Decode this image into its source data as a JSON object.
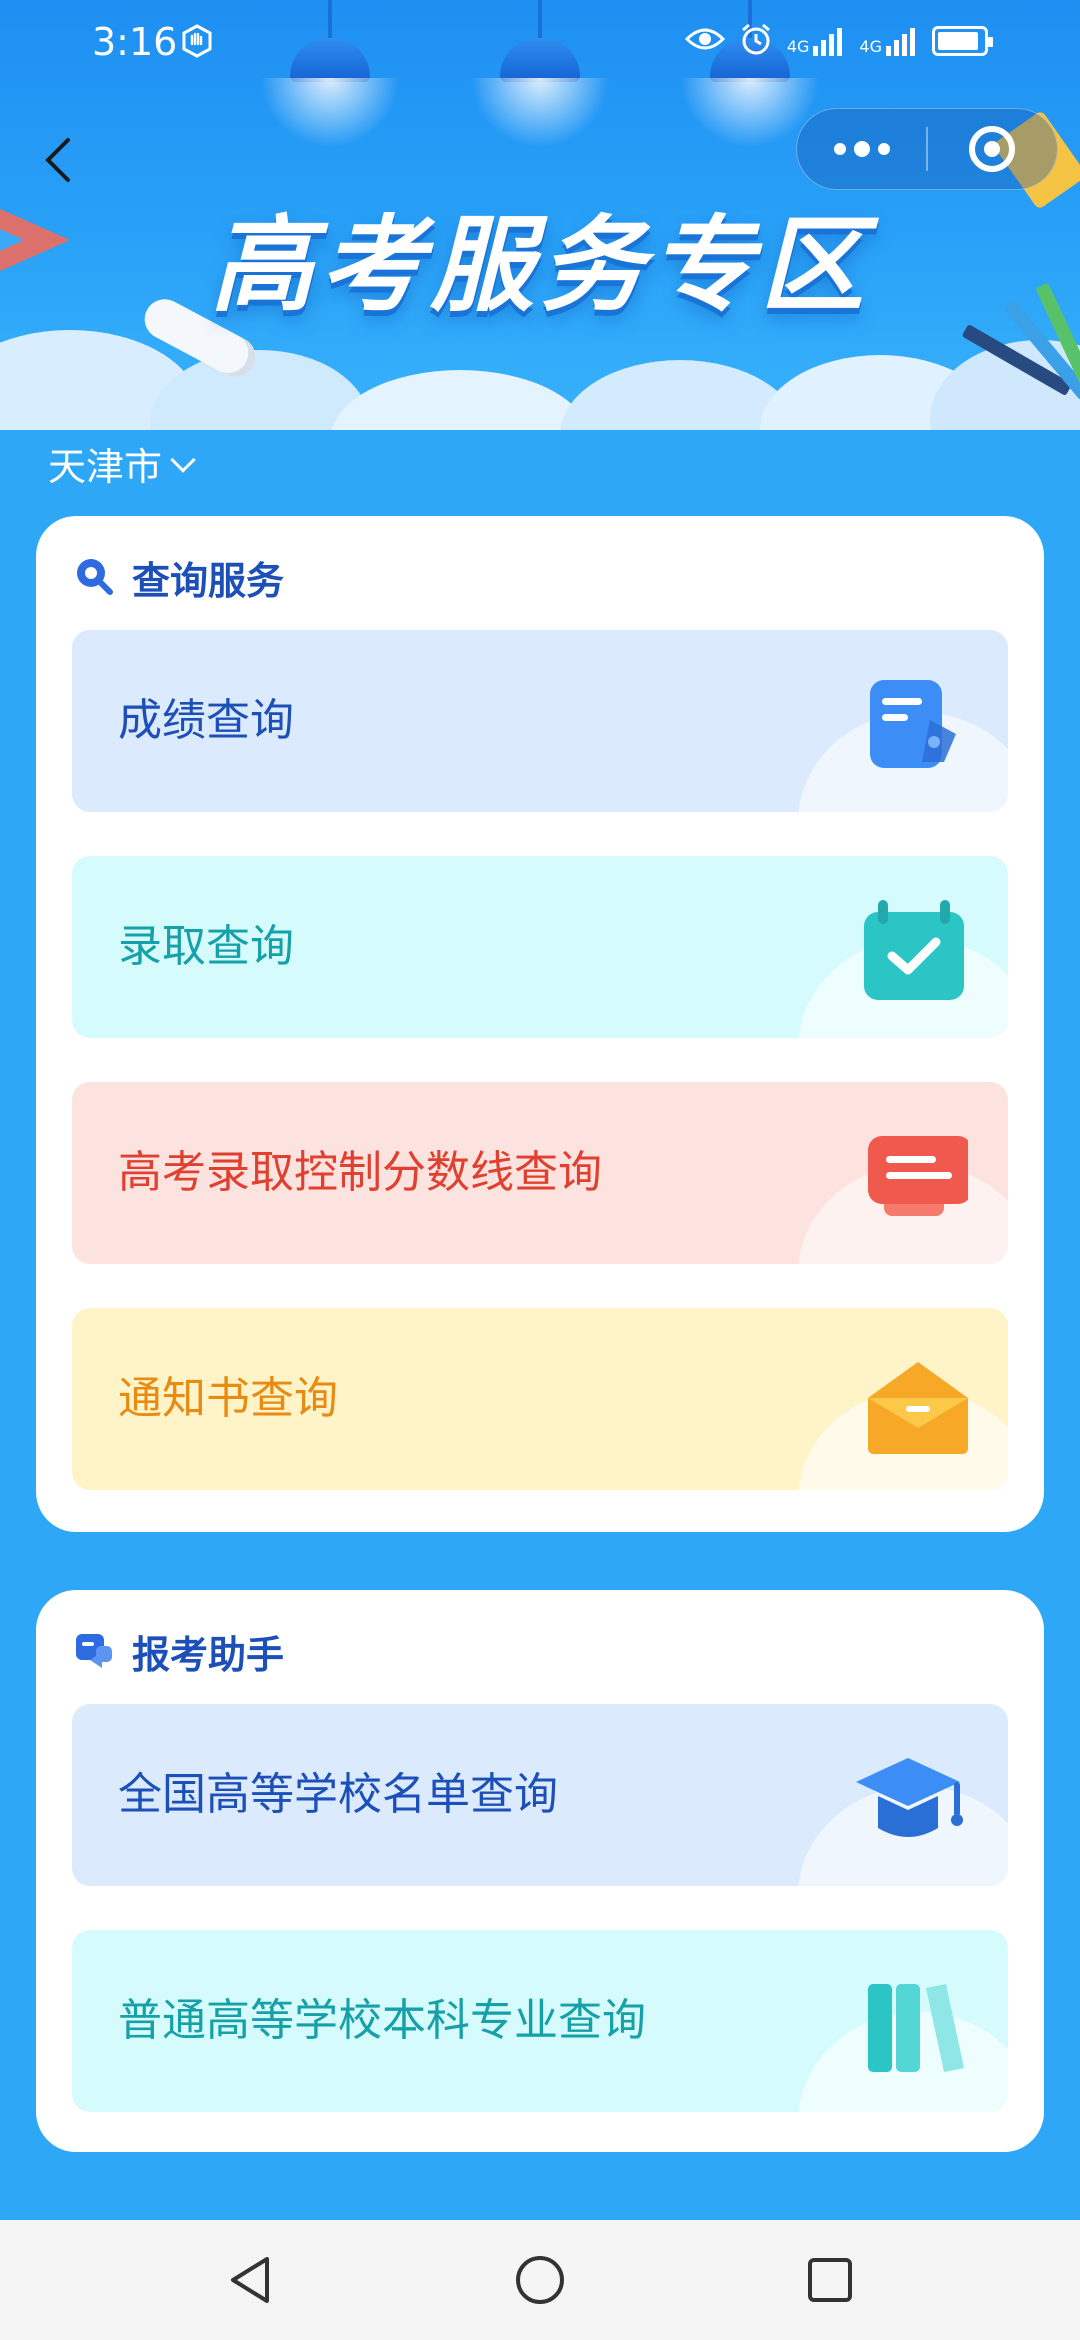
{
  "status_bar": {
    "time": "3:16",
    "signal1": "4G",
    "signal2": "4G"
  },
  "banner": {
    "title": "高考服务专区"
  },
  "city_selector": {
    "city": "天津市"
  },
  "query_section": {
    "title": "查询服务",
    "items": [
      {
        "label": "成绩查询",
        "icon": "score-report-icon",
        "theme": "blue"
      },
      {
        "label": "录取查询",
        "icon": "calendar-check-icon",
        "theme": "cyan"
      },
      {
        "label": "高考录取控制分数线查询",
        "icon": "message-card-icon",
        "theme": "red"
      },
      {
        "label": "通知书查询",
        "icon": "envelope-icon",
        "theme": "yellow"
      }
    ]
  },
  "assistant_section": {
    "title": "报考助手",
    "items": [
      {
        "label": "全国高等学校名单查询",
        "icon": "graduation-cap-icon",
        "theme": "blue"
      },
      {
        "label": "普通高等学校本科专业查询",
        "icon": "books-icon",
        "theme": "cyan"
      }
    ]
  },
  "colors": {
    "page_background": "#2ea7f7",
    "section_title": "#1d4fb8",
    "blue_label": "#1d4fb8",
    "cyan_label": "#16a0a8",
    "red_label": "#e0402f",
    "yellow_label": "#e98a12"
  }
}
